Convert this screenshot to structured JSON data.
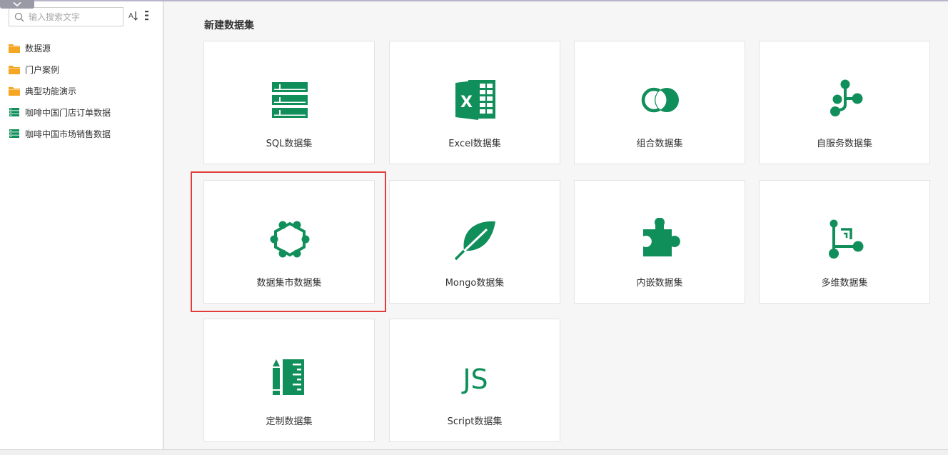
{
  "colors": {
    "accent_green": "#108f5a",
    "folder_orange": "#f5a623",
    "highlight_red": "#e43c3c"
  },
  "toolbar": {
    "collapse_icon": "chevron-down-icon",
    "sort_icon": "sort-icon",
    "menu_icon": "more-vertical-icon"
  },
  "search": {
    "placeholder": "输入搜索文字",
    "value": ""
  },
  "sidebar": {
    "items": [
      {
        "label": "数据源",
        "icon": "folder-icon"
      },
      {
        "label": "门户案例",
        "icon": "folder-icon"
      },
      {
        "label": "典型功能演示",
        "icon": "folder-icon"
      },
      {
        "label": "咖啡中国门店订单数据",
        "icon": "dataset-icon"
      },
      {
        "label": "咖啡中国市场销售数据",
        "icon": "dataset-icon"
      }
    ]
  },
  "main": {
    "title": "新建数据集",
    "cards": [
      {
        "label": "SQL数据集",
        "icon": "sql-table-icon"
      },
      {
        "label": "Excel数据集",
        "icon": "excel-icon"
      },
      {
        "label": "组合数据集",
        "icon": "combine-circles-icon"
      },
      {
        "label": "自服务数据集",
        "icon": "self-service-flow-icon"
      },
      {
        "label": "数据集市数据集",
        "icon": "hexagon-network-icon"
      },
      {
        "label": "Mongo数据集",
        "icon": "leaf-icon"
      },
      {
        "label": "内嵌数据集",
        "icon": "puzzle-icon"
      },
      {
        "label": "多维数据集",
        "icon": "multidimensional-icon"
      },
      {
        "label": "定制数据集",
        "icon": "pencil-ruler-icon"
      },
      {
        "label": "Script数据集",
        "icon": "js-script-icon"
      }
    ],
    "highlighted_card": "数据集市数据集"
  }
}
